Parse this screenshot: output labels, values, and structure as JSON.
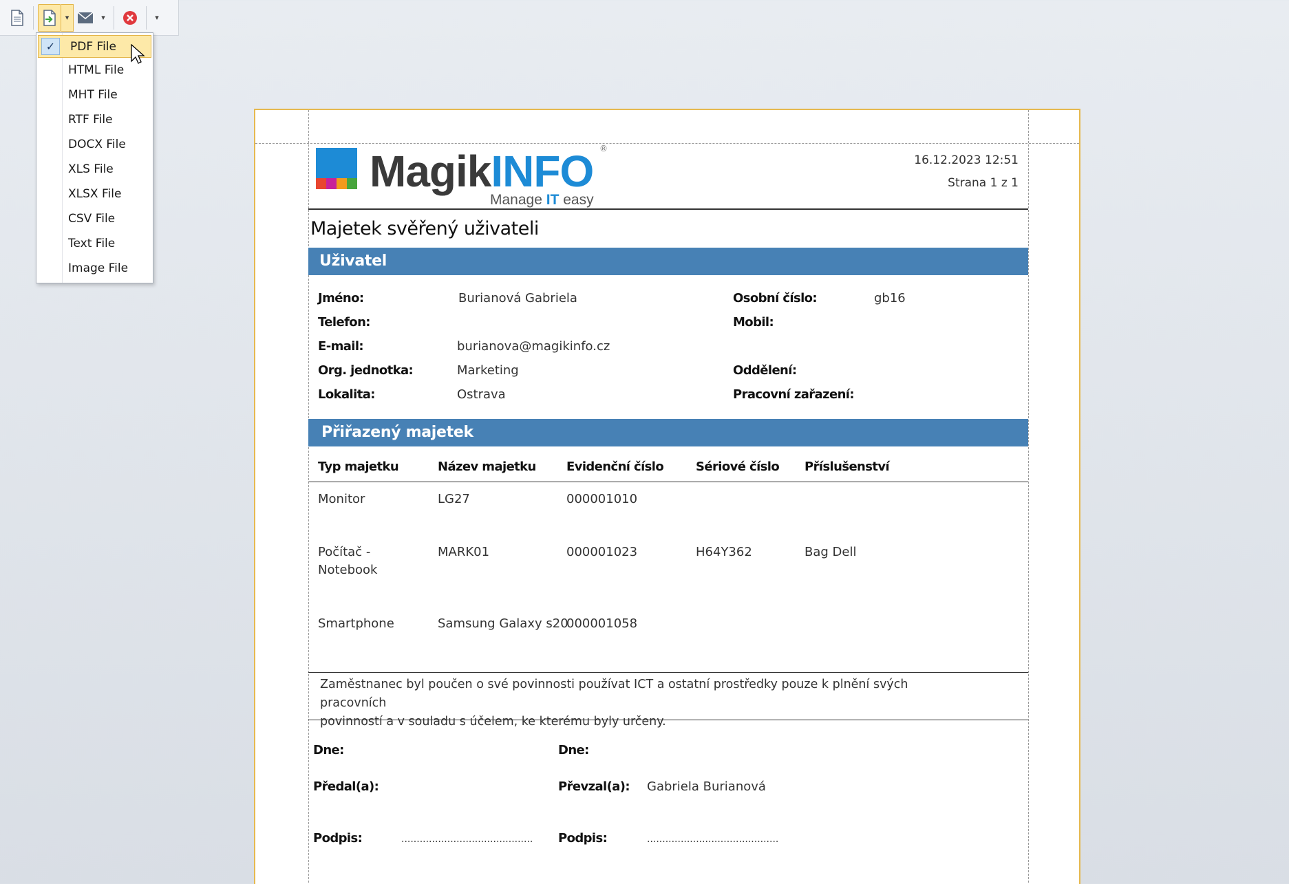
{
  "toolbar": {
    "icons": [
      "document-icon",
      "export-icon",
      "email-icon",
      "close-icon"
    ]
  },
  "export_menu": {
    "items": [
      {
        "label": "PDF File",
        "selected": true
      },
      {
        "label": "HTML File"
      },
      {
        "label": "MHT File"
      },
      {
        "label": "RTF File"
      },
      {
        "label": "DOCX File"
      },
      {
        "label": "XLS File"
      },
      {
        "label": "XLSX File"
      },
      {
        "label": "CSV File"
      },
      {
        "label": "Text File"
      },
      {
        "label": "Image File"
      }
    ]
  },
  "report": {
    "logo": {
      "brand_dark": "Magik",
      "brand_blue": "INFO",
      "tagline_pre": "Manage",
      "tagline_it": "IT",
      "tagline_post": "easy",
      "registered": "®"
    },
    "timestamp": "16.12.2023 12:51",
    "page_info": "Strana 1 z 1",
    "title": "Majetek svěřený uživateli",
    "section_user": "Uživatel",
    "user": {
      "name_label": "Jméno:",
      "name": "Burianová Gabriela",
      "personal_no_label": "Osobní číslo:",
      "personal_no": "gb16",
      "phone_label": "Telefon:",
      "mobile_label": "Mobil:",
      "email_label": "E-mail:",
      "email": "burianova@magikinfo.cz",
      "org_unit_label": "Org. jednotka:",
      "org_unit": "Marketing",
      "department_label": "Oddělení:",
      "location_label": "Lokalita:",
      "location": "Ostrava",
      "position_label": "Pracovní zařazení:"
    },
    "section_assets": "Přiřazený majetek",
    "asset_columns": [
      "Typ majetku",
      "Název majetku",
      "Evidenční číslo",
      "Sériové číslo",
      "Příslušenství"
    ],
    "assets": [
      {
        "type_l1": "Monitor",
        "type_l2": "",
        "name": "LG27",
        "inv_no": "000001010",
        "serial": "",
        "accessories": ""
      },
      {
        "type_l1": "Počítač -",
        "type_l2": "Notebook",
        "name": "MARK01",
        "inv_no": "000001023",
        "serial": "H64Y362",
        "accessories": "Bag Dell"
      },
      {
        "type_l1": "Smartphone",
        "type_l2": "",
        "name": "Samsung Galaxy s20",
        "inv_no": "000001058",
        "serial": "",
        "accessories": ""
      }
    ],
    "notice_l1": "Zaměstnanec byl poučen o své povinnosti používat ICT a ostatní prostředky pouze k plnění svých pracovních",
    "notice_l2": "povinností a v souladu s účelem, ke kterému byly určeny.",
    "sign": {
      "date_label": "Dne:",
      "handed_label": "Předal(a):",
      "received_label": "Převzal(a):",
      "received_name": "Gabriela Burianová",
      "signature_label": "Podpis:",
      "signature_line": "..........................................."
    }
  },
  "colors": {
    "band": "#4781b5",
    "page_border": "#e6b94f",
    "menu_highlight": "#fde9a8"
  }
}
